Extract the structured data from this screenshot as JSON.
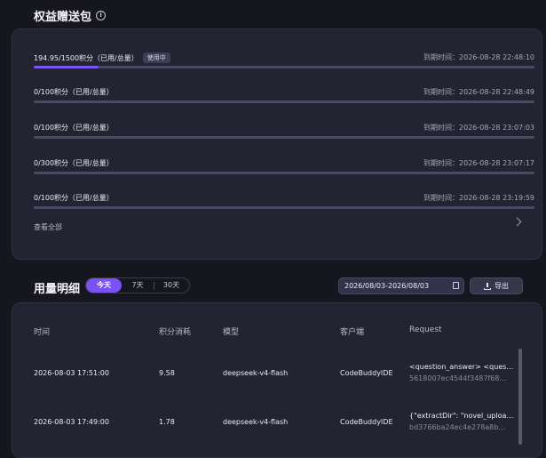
{
  "packs": {
    "title": "权益赠送包",
    "info_icon": "i",
    "view_all": "查看全部",
    "items": [
      {
        "label": "194.95/1500积分（已用/总量）",
        "badge": "使用中",
        "expiry": "到期时间：2026-08-28 22:48:10",
        "progress": 0.13
      },
      {
        "label": "0/100积分（已用/总量）",
        "badge": "",
        "expiry": "到期时间：2026-08-28 22:48:49",
        "progress": 0
      },
      {
        "label": "0/100积分（已用/总量）",
        "badge": "",
        "expiry": "到期时间：2026-08-28 23:07:03",
        "progress": 0
      },
      {
        "label": "0/300积分（已用/总量）",
        "badge": "",
        "expiry": "到期时间：2026-08-28 23:07:17",
        "progress": 0
      },
      {
        "label": "0/100积分（已用/总量）",
        "badge": "",
        "expiry": "到期时间：2026-08-28 23:19:59",
        "progress": 0
      }
    ]
  },
  "usage": {
    "title": "用量明细",
    "tabs": [
      "今天",
      "7天",
      "30天"
    ],
    "active_tab": "今天",
    "date_range": "2026/08/03-2026/08/03",
    "export_label": "导出",
    "columns": [
      "时间",
      "积分消耗",
      "模型",
      "客户端",
      "Request"
    ],
    "rows": [
      {
        "time": "2026-08-03 17:51:00",
        "points": "9.58",
        "model": "deepseek-v4-flash",
        "client": "CodeBuddyIDE",
        "request": "<question_answer> <questio…",
        "request_id": "5618007ec4544f3487f68…"
      },
      {
        "time": "2026-08-03 17:49:00",
        "points": "1.78",
        "model": "deepseek-v4-flash",
        "client": "CodeBuddyIDE",
        "request": "{\"extractDir\": \"novel_upload…",
        "request_id": "bd3766ba24ec4e278a8b…"
      }
    ]
  },
  "colors": {
    "accent": "#7a52f4",
    "background": "#16161e",
    "card": "#232331"
  }
}
